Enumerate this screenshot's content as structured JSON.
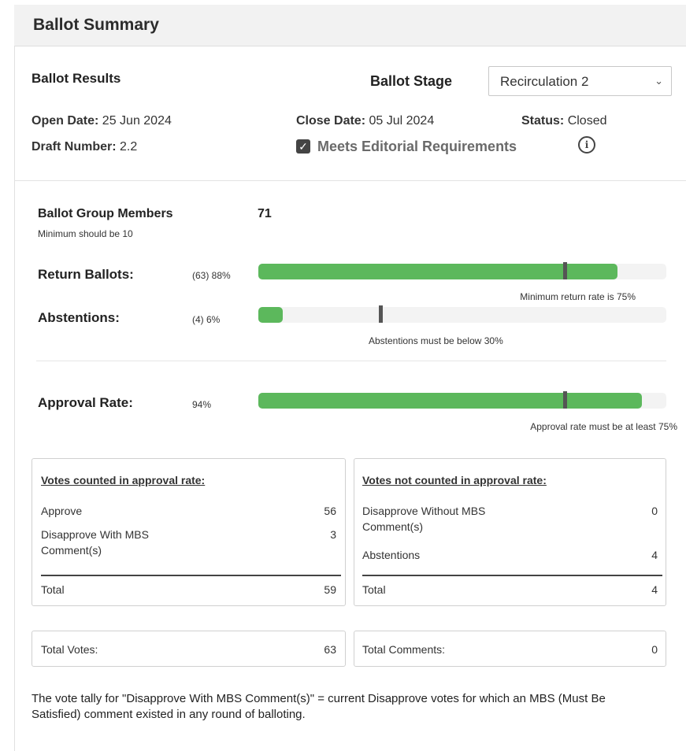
{
  "panel": {
    "title": "Ballot Summary"
  },
  "results": {
    "heading": "Ballot Results",
    "stage_label": "Ballot Stage",
    "stage_value": "Recirculation 2",
    "open_date_label": "Open Date:",
    "open_date": "25 Jun 2024",
    "close_date_label": "Close Date:",
    "close_date": "05 Jul 2024",
    "status_label": "Status:",
    "status": "Closed",
    "draft_label": "Draft Number:",
    "draft": "2.2",
    "editorial_label": "Meets Editorial Requirements",
    "editorial_checked": true,
    "info_icon": "info-icon",
    "chevron_icon": "chevron-down-icon"
  },
  "members": {
    "label": "Ballot Group Members",
    "count": "71",
    "minimum_note": "Minimum should be 10"
  },
  "return": {
    "label": "Return Ballots:",
    "value": "(63) 88%",
    "fraction": 0.88,
    "threshold": 0.75,
    "note": "Minimum return rate is 75%"
  },
  "abstentions": {
    "label": "Abstentions:",
    "value": "(4) 6%",
    "fraction": 0.06,
    "threshold": 0.3,
    "note": "Abstentions must be below 30%"
  },
  "approval": {
    "label": "Approval Rate:",
    "value": "94%",
    "fraction": 0.94,
    "threshold": 0.75,
    "note": "Approval rate must be at least 75%"
  },
  "counted": {
    "title": "Votes counted in approval rate:",
    "rows": [
      {
        "label": "Approve",
        "value": "56"
      },
      {
        "label": "Disapprove With MBS Comment(s)",
        "value": "3"
      }
    ],
    "total_label": "Total",
    "total": "59"
  },
  "not_counted": {
    "title": "Votes not counted in approval rate:",
    "rows": [
      {
        "label": "Disapprove Without MBS Comment(s)",
        "value": "0"
      },
      {
        "label": "Abstentions",
        "value": "4"
      }
    ],
    "total_label": "Total",
    "total": "4"
  },
  "totals": {
    "votes_label": "Total Votes:",
    "votes": "63",
    "comments_label": "Total Comments:",
    "comments": "0"
  },
  "footer": "The vote tally for \"Disapprove With MBS Comment(s)\" = current Disapprove votes for which an MBS (Must Be Satisfied) comment existed in any round of balloting.",
  "colors": {
    "bar_fill": "#5cb85c",
    "bar_track": "#f3f3f3",
    "marker": "#555555"
  }
}
